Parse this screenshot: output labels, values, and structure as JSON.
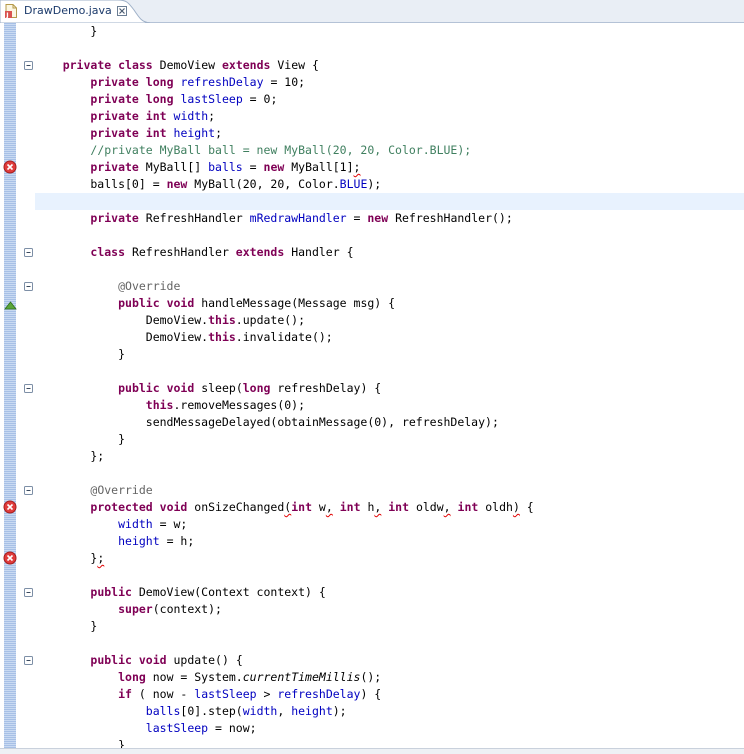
{
  "tab": {
    "title": "DrawDemo.java",
    "close_symbol": "☒"
  },
  "lines": [
    {
      "t": 0,
      "fold": false,
      "seg": [
        [
          "",
          "        }"
        ]
      ]
    },
    {
      "t": 1,
      "blank": true
    },
    {
      "t": 2,
      "fold": true,
      "seg": [
        [
          "",
          "    "
        ],
        [
          "kw",
          "private"
        ],
        [
          "",
          " "
        ],
        [
          "kw",
          "class"
        ],
        [
          "",
          " DemoView "
        ],
        [
          "kw",
          "extends"
        ],
        [
          "",
          " View {"
        ]
      ]
    },
    {
      "t": 3,
      "seg": [
        [
          "",
          "        "
        ],
        [
          "kw",
          "private"
        ],
        [
          "",
          " "
        ],
        [
          "kw",
          "long"
        ],
        [
          "",
          " "
        ],
        [
          "fld",
          "refreshDelay"
        ],
        [
          "",
          " = 10;"
        ]
      ]
    },
    {
      "t": 4,
      "seg": [
        [
          "",
          "        "
        ],
        [
          "kw",
          "private"
        ],
        [
          "",
          " "
        ],
        [
          "kw",
          "long"
        ],
        [
          "",
          " "
        ],
        [
          "fld",
          "lastSleep"
        ],
        [
          "",
          " = 0;"
        ]
      ]
    },
    {
      "t": 5,
      "seg": [
        [
          "",
          "        "
        ],
        [
          "kw",
          "private"
        ],
        [
          "",
          " "
        ],
        [
          "kw",
          "int"
        ],
        [
          "",
          " "
        ],
        [
          "fld",
          "width"
        ],
        [
          "",
          ";"
        ]
      ]
    },
    {
      "t": 6,
      "seg": [
        [
          "",
          "        "
        ],
        [
          "kw",
          "private"
        ],
        [
          "",
          " "
        ],
        [
          "kw",
          "int"
        ],
        [
          "",
          " "
        ],
        [
          "fld",
          "height"
        ],
        [
          "",
          ";"
        ]
      ]
    },
    {
      "t": 7,
      "seg": [
        [
          "",
          "        "
        ],
        [
          "cmt",
          "//private MyBall ball = new MyBall(20, 20, Color.BLUE);"
        ]
      ]
    },
    {
      "t": 8,
      "error": true,
      "seg": [
        [
          "",
          "        "
        ],
        [
          "kw",
          "private"
        ],
        [
          "",
          " MyBall[] "
        ],
        [
          "fld",
          "balls"
        ],
        [
          "",
          " = "
        ],
        [
          "kw",
          "new"
        ],
        [
          "",
          " MyBall[1]"
        ],
        [
          "err",
          ";"
        ]
      ]
    },
    {
      "t": 9,
      "seg": [
        [
          "",
          "        balls[0] = "
        ],
        [
          "kw",
          "new"
        ],
        [
          "",
          " MyBall(20, 20, Color."
        ],
        [
          "fld",
          "BLUE"
        ],
        [
          "",
          ");"
        ]
      ]
    },
    {
      "t": 10,
      "blank": true,
      "current": true
    },
    {
      "t": 11,
      "seg": [
        [
          "",
          "        "
        ],
        [
          "kw",
          "private"
        ],
        [
          "",
          " RefreshHandler "
        ],
        [
          "fld",
          "mRedrawHandler"
        ],
        [
          "",
          " = "
        ],
        [
          "kw",
          "new"
        ],
        [
          "",
          " RefreshHandler();"
        ]
      ]
    },
    {
      "t": 12,
      "blank": true
    },
    {
      "t": 13,
      "fold": true,
      "seg": [
        [
          "",
          "        "
        ],
        [
          "kw",
          "class"
        ],
        [
          "",
          " RefreshHandler "
        ],
        [
          "kw",
          "extends"
        ],
        [
          "",
          " Handler {"
        ]
      ]
    },
    {
      "t": 14,
      "blank": true
    },
    {
      "t": 15,
      "fold": true,
      "seg": [
        [
          "",
          "            "
        ],
        [
          "ann",
          "@Override"
        ]
      ]
    },
    {
      "t": 16,
      "override": true,
      "seg": [
        [
          "",
          "            "
        ],
        [
          "kw",
          "public"
        ],
        [
          "",
          " "
        ],
        [
          "kw",
          "void"
        ],
        [
          "",
          " handleMessage(Message msg) {"
        ]
      ]
    },
    {
      "t": 17,
      "seg": [
        [
          "",
          "                DemoView."
        ],
        [
          "kw",
          "this"
        ],
        [
          "",
          ".update();"
        ]
      ]
    },
    {
      "t": 18,
      "seg": [
        [
          "",
          "                DemoView."
        ],
        [
          "kw",
          "this"
        ],
        [
          "",
          ".invalidate();"
        ]
      ]
    },
    {
      "t": 19,
      "seg": [
        [
          "",
          "            }"
        ]
      ]
    },
    {
      "t": 20,
      "blank": true
    },
    {
      "t": 21,
      "fold": true,
      "seg": [
        [
          "",
          "            "
        ],
        [
          "kw",
          "public"
        ],
        [
          "",
          " "
        ],
        [
          "kw",
          "void"
        ],
        [
          "",
          " sleep("
        ],
        [
          "kw",
          "long"
        ],
        [
          "",
          " refreshDelay) {"
        ]
      ]
    },
    {
      "t": 22,
      "seg": [
        [
          "",
          "                "
        ],
        [
          "kw",
          "this"
        ],
        [
          "",
          ".removeMessages(0);"
        ]
      ]
    },
    {
      "t": 23,
      "seg": [
        [
          "",
          "                sendMessageDelayed(obtainMessage(0), refreshDelay);"
        ]
      ]
    },
    {
      "t": 24,
      "seg": [
        [
          "",
          "            }"
        ]
      ]
    },
    {
      "t": 25,
      "seg": [
        [
          "",
          "        };"
        ]
      ]
    },
    {
      "t": 26,
      "blank": true
    },
    {
      "t": 27,
      "fold": true,
      "seg": [
        [
          "",
          "        "
        ],
        [
          "ann",
          "@Override"
        ]
      ]
    },
    {
      "t": 28,
      "error": true,
      "seg": [
        [
          "",
          "        "
        ],
        [
          "kw",
          "protected"
        ],
        [
          "",
          " "
        ],
        [
          "kw",
          "void"
        ],
        [
          "",
          " onSizeChanged"
        ],
        [
          "err",
          "("
        ],
        [
          "kw",
          "int"
        ],
        [
          "",
          " w"
        ],
        [
          "err",
          ","
        ],
        [
          "",
          " "
        ],
        [
          "kw",
          "int"
        ],
        [
          "",
          " h"
        ],
        [
          "err",
          ","
        ],
        [
          "",
          " "
        ],
        [
          "kw",
          "int"
        ],
        [
          "",
          " oldw"
        ],
        [
          "err",
          ","
        ],
        [
          "",
          " "
        ],
        [
          "kw",
          "int"
        ],
        [
          "",
          " oldh"
        ],
        [
          "err",
          ")"
        ],
        [
          "",
          " {"
        ]
      ]
    },
    {
      "t": 29,
      "seg": [
        [
          "",
          "            "
        ],
        [
          "fld",
          "width"
        ],
        [
          "",
          " = w;"
        ]
      ]
    },
    {
      "t": 30,
      "seg": [
        [
          "",
          "            "
        ],
        [
          "fld",
          "height"
        ],
        [
          "",
          " = h;"
        ]
      ]
    },
    {
      "t": 31,
      "error": true,
      "seg": [
        [
          "",
          "        }"
        ],
        [
          "err",
          ";"
        ]
      ]
    },
    {
      "t": 32,
      "blank": true
    },
    {
      "t": 33,
      "fold": true,
      "seg": [
        [
          "",
          "        "
        ],
        [
          "kw",
          "public"
        ],
        [
          "",
          " DemoView(Context context) {"
        ]
      ]
    },
    {
      "t": 34,
      "seg": [
        [
          "",
          "            "
        ],
        [
          "kw",
          "super"
        ],
        [
          "",
          "(context);"
        ]
      ]
    },
    {
      "t": 35,
      "seg": [
        [
          "",
          "        }"
        ]
      ]
    },
    {
      "t": 36,
      "blank": true
    },
    {
      "t": 37,
      "fold": true,
      "seg": [
        [
          "",
          "        "
        ],
        [
          "kw",
          "public"
        ],
        [
          "",
          " "
        ],
        [
          "kw",
          "void"
        ],
        [
          "",
          " update() {"
        ]
      ]
    },
    {
      "t": 38,
      "seg": [
        [
          "",
          "            "
        ],
        [
          "kw",
          "long"
        ],
        [
          "",
          " now = System."
        ],
        [
          "stat",
          "currentTimeMillis"
        ],
        [
          "",
          "();"
        ]
      ]
    },
    {
      "t": 39,
      "seg": [
        [
          "",
          "            "
        ],
        [
          "kw",
          "if"
        ],
        [
          "",
          " ( now - "
        ],
        [
          "fld",
          "lastSleep"
        ],
        [
          "",
          " > "
        ],
        [
          "fld",
          "refreshDelay"
        ],
        [
          "",
          ") {"
        ]
      ]
    },
    {
      "t": 40,
      "seg": [
        [
          "",
          "                "
        ],
        [
          "fld",
          "balls"
        ],
        [
          "",
          "[0].step("
        ],
        [
          "fld",
          "width"
        ],
        [
          "",
          ", "
        ],
        [
          "fld",
          "height"
        ],
        [
          "",
          ");"
        ]
      ]
    },
    {
      "t": 41,
      "seg": [
        [
          "",
          "                "
        ],
        [
          "fld",
          "lastSleep"
        ],
        [
          "",
          " = now;"
        ]
      ]
    },
    {
      "t": 42,
      "seg": [
        [
          "",
          "            }"
        ]
      ]
    }
  ]
}
